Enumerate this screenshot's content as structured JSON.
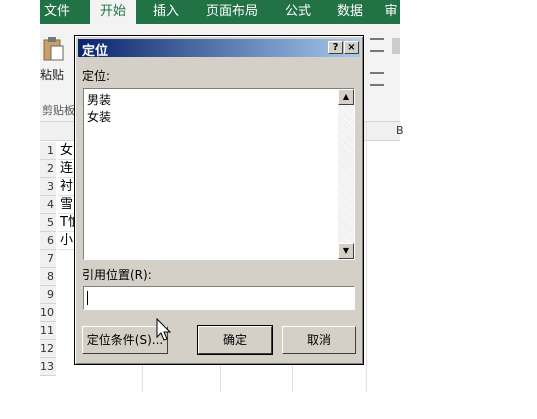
{
  "ribbon": {
    "tabs": [
      {
        "label": "文件"
      },
      {
        "label": "开始"
      },
      {
        "label": "插入"
      },
      {
        "label": "页面布局"
      },
      {
        "label": "公式"
      },
      {
        "label": "数据"
      },
      {
        "label": "审"
      }
    ],
    "active_tab": "开始",
    "paste_label": "粘贴",
    "clipboard_label": "剪贴板",
    "accent": "#217346"
  },
  "sheet": {
    "row_numbers": [
      "1",
      "2",
      "3",
      "4",
      "5",
      "6",
      "7",
      "8",
      "9",
      "10",
      "11",
      "12",
      "13"
    ],
    "column_a": [
      "女",
      "连",
      "衬",
      "雪",
      "T恤",
      "小"
    ],
    "column_b_header": "B"
  },
  "dialog": {
    "title": "定位",
    "help_button": "?",
    "close_button": "×",
    "goto_label": "定位:",
    "goto_items": [
      "男装",
      "女装"
    ],
    "reference_label": "引用位置(R):",
    "reference_value": "",
    "special_button": "定位条件(S)...",
    "ok_button": "确定",
    "cancel_button": "取消"
  }
}
